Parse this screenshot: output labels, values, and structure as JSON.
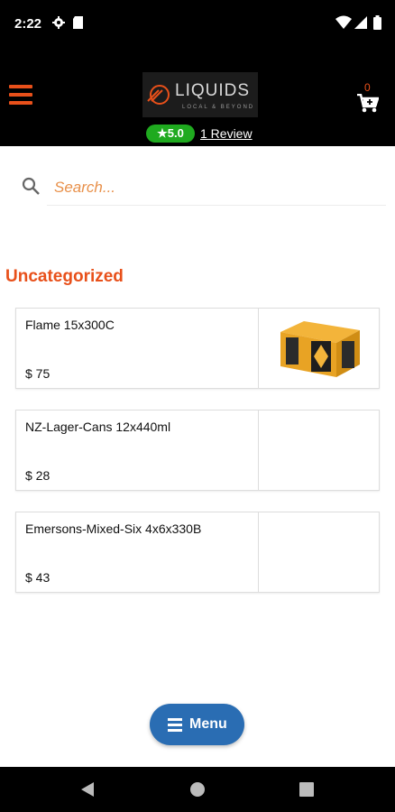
{
  "status_bar": {
    "time": "2:22"
  },
  "header": {
    "logo": {
      "brand": "LIQUIDS",
      "tagline": "LOCAL & BEYOND"
    },
    "cart_count": "0",
    "rating": "★5.0",
    "review_link": "1 Review"
  },
  "search": {
    "placeholder": "Search..."
  },
  "section": {
    "title": "Uncategorized"
  },
  "products": [
    {
      "name": "Flame 15x300C",
      "price": "$ 75"
    },
    {
      "name": "NZ-Lager-Cans 12x440ml",
      "price": "$ 28"
    },
    {
      "name": "Emersons-Mixed-Six 4x6x330B",
      "price": "$ 43"
    }
  ],
  "menu_button": {
    "label": "Menu"
  },
  "colors": {
    "accent": "#e8501a",
    "rating_green": "#1faa1f",
    "menu_blue": "#2a6db3"
  }
}
